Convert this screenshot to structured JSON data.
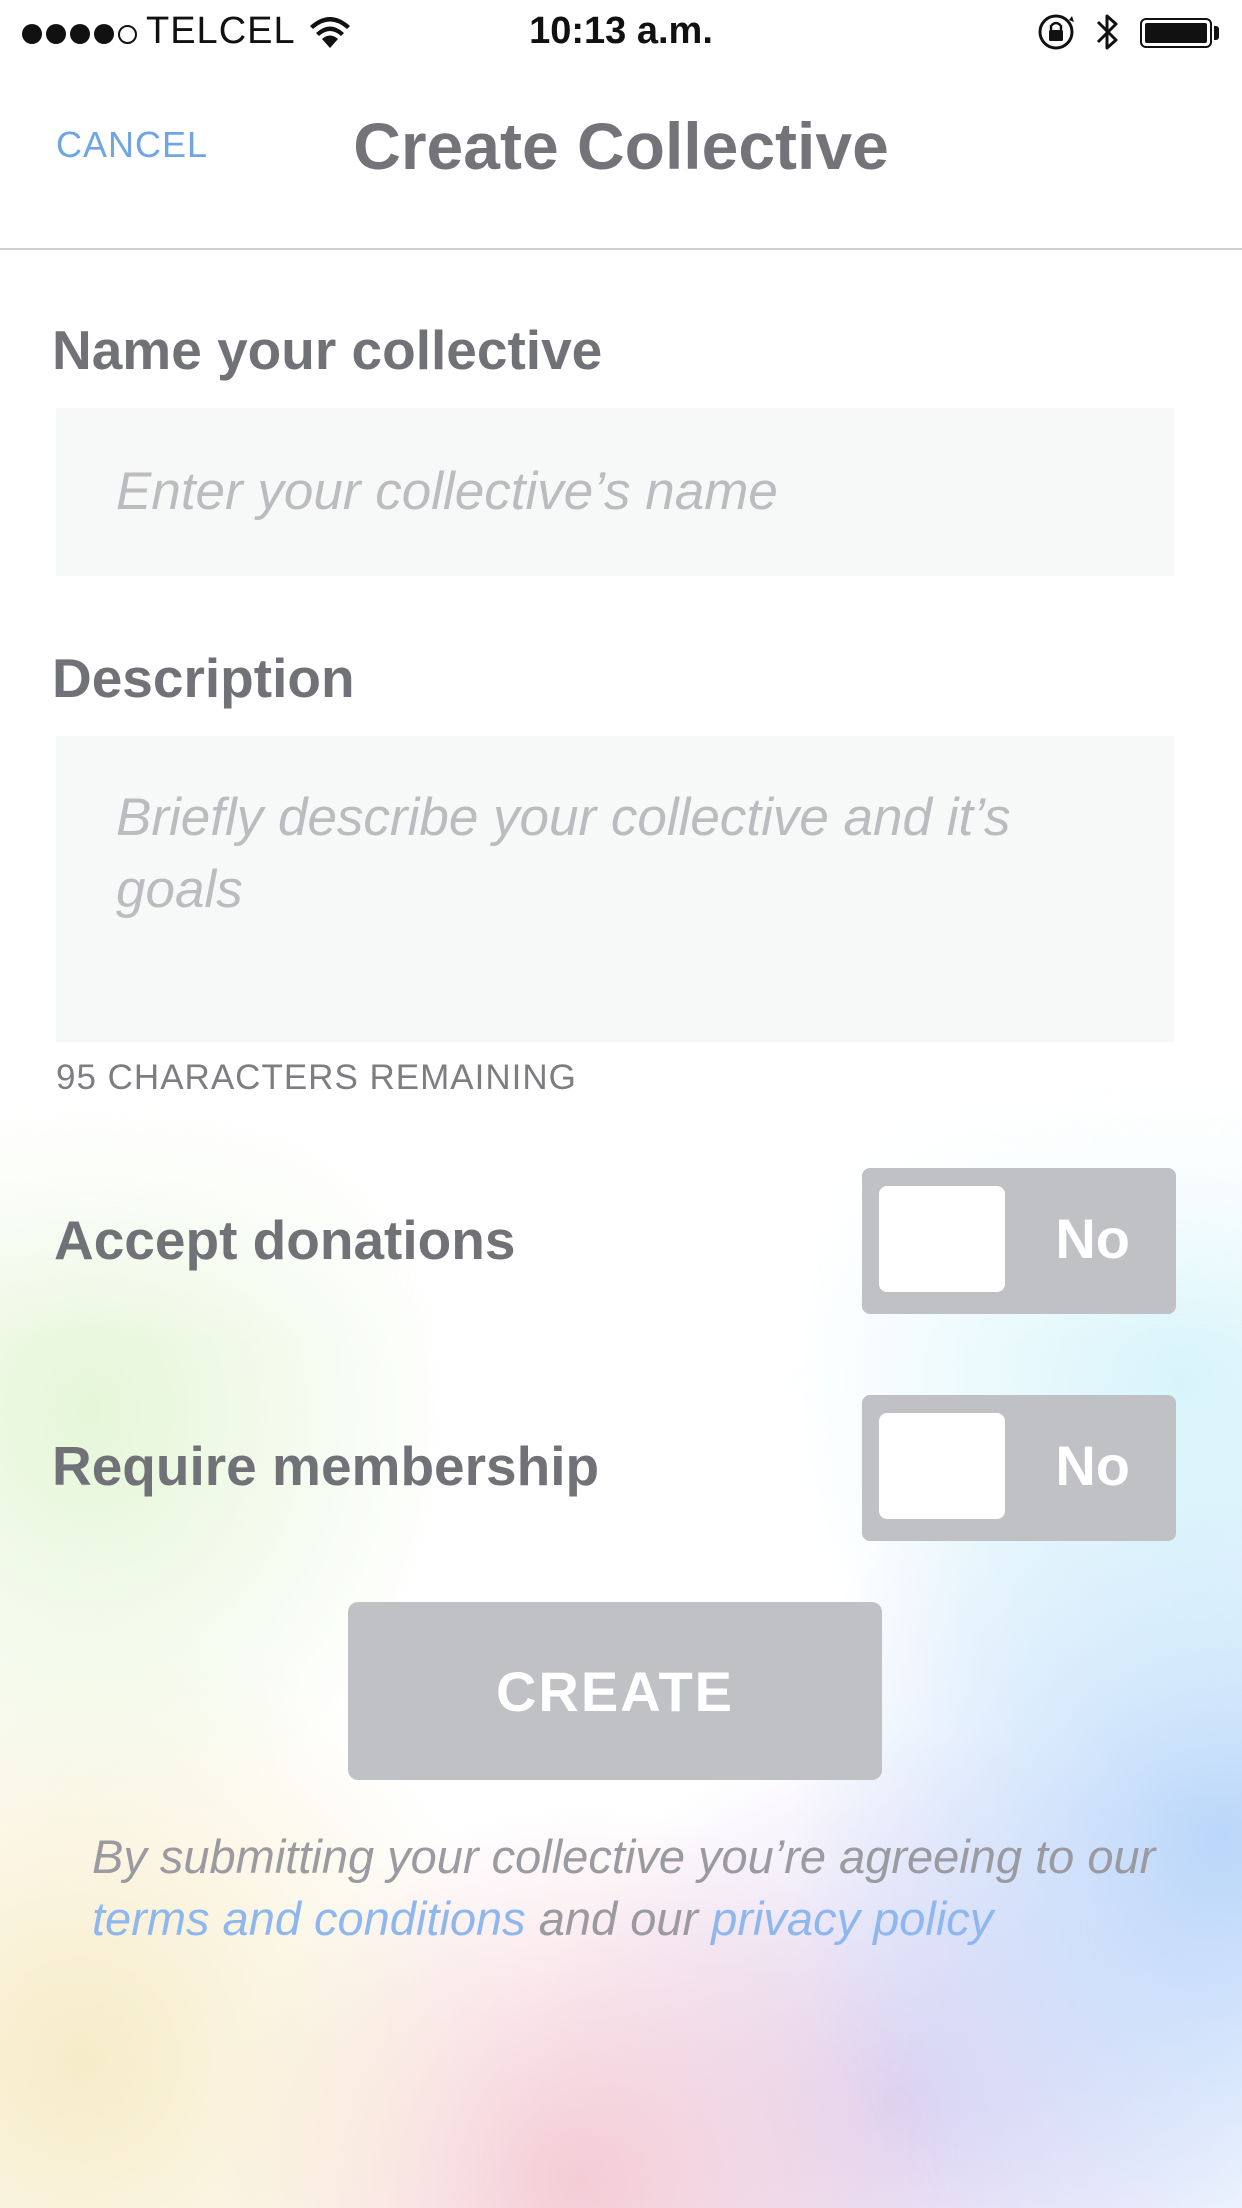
{
  "status_bar": {
    "carrier": "TELCEL",
    "time": "10:13 a.m."
  },
  "nav": {
    "cancel_label": "CANCEL",
    "title": "Create Collective"
  },
  "form": {
    "name_label": "Name your collective",
    "name_placeholder": "Enter your collective’s name",
    "description_label": "Description",
    "description_placeholder": "Briefly describe your collective and it’s goals",
    "characters_remaining": "95 CHARACTERS REMAINING",
    "accept_donations_label": "Accept donations",
    "accept_donations_value": "No",
    "require_membership_label": "Require membership",
    "require_membership_value": "No",
    "create_label": "CREATE"
  },
  "footer": {
    "text_1": "By submitting your collective you’re agreeing to our ",
    "terms_link": "terms and conditions",
    "text_2": " and our ",
    "privacy_link": "privacy policy"
  },
  "colors": {
    "accent_link": "#6fa4e7",
    "toggle_off": "#c0c1c4",
    "field_bg": "#f7f8f8"
  },
  "icons": [
    "signal-strength-icon",
    "wifi-icon",
    "orientation-lock-icon",
    "bluetooth-icon",
    "battery-icon"
  ]
}
